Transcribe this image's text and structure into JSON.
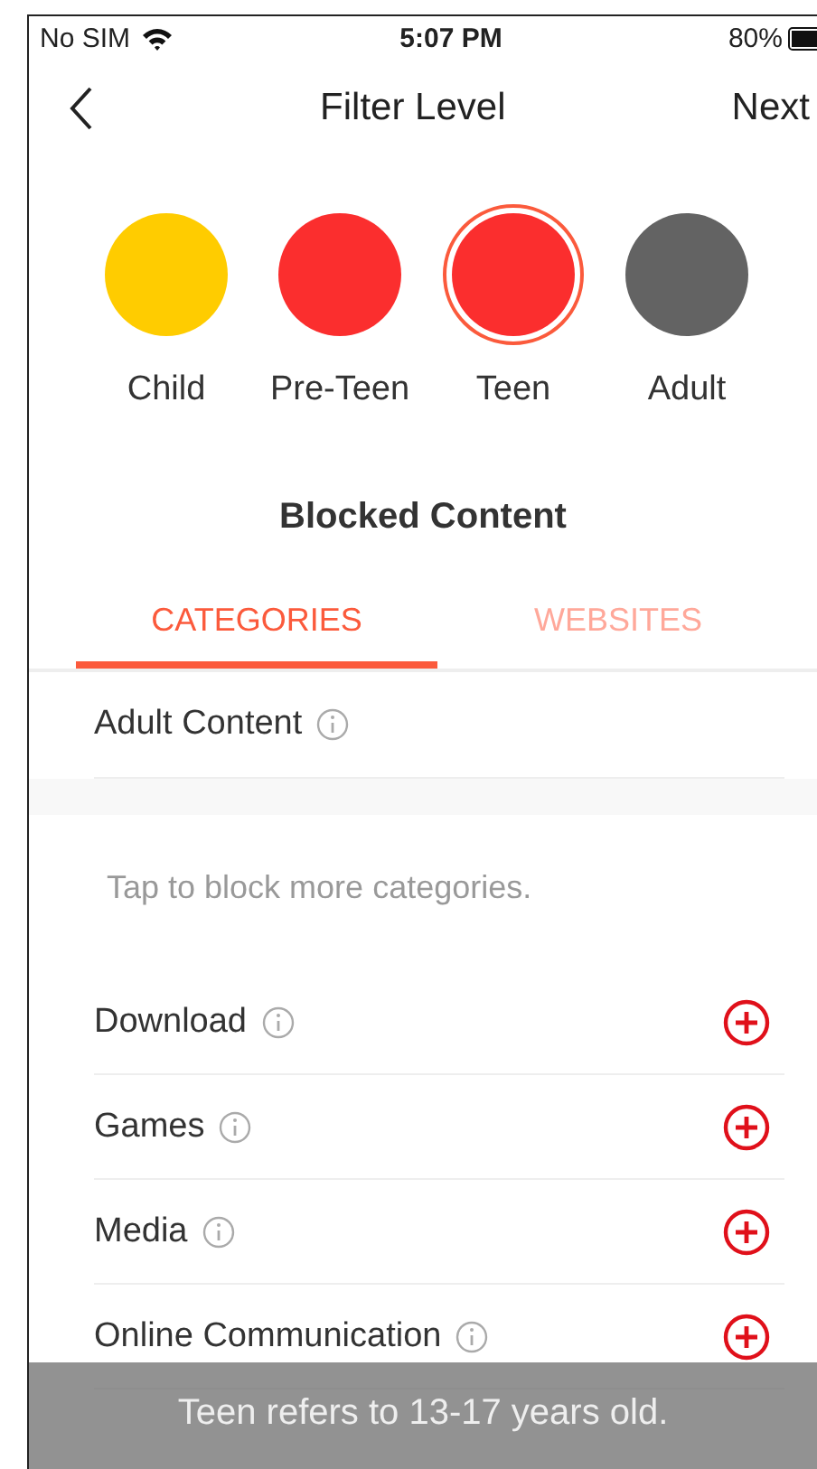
{
  "status_bar": {
    "carrier": "No SIM",
    "time": "5:07 PM",
    "battery": "80%"
  },
  "nav": {
    "title": "Filter Level",
    "action": "Next"
  },
  "levels": [
    {
      "label": "Child",
      "color": "#ffcc00",
      "selected": false
    },
    {
      "label": "Pre-Teen",
      "color": "#fb2e2e",
      "selected": false
    },
    {
      "label": "Teen",
      "color": "#fb2e2e",
      "selected": true
    },
    {
      "label": "Adult",
      "color": "#636363",
      "selected": false
    }
  ],
  "section_title": "Blocked Content",
  "tabs": [
    {
      "label": "CATEGORIES",
      "selected": true
    },
    {
      "label": "WEBSITES",
      "selected": false
    }
  ],
  "blocked": [
    {
      "label": "Adult Content"
    }
  ],
  "hint": "Tap to block more categories.",
  "categories": [
    {
      "label": "Download"
    },
    {
      "label": "Games"
    },
    {
      "label": "Media"
    },
    {
      "label": "Online Communication"
    }
  ],
  "toast": "Teen refers to 13-17 years old."
}
